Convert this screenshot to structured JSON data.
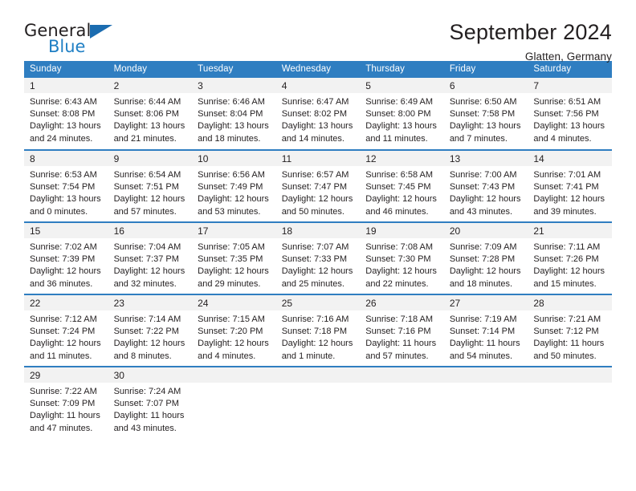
{
  "brand": {
    "name_top": "General",
    "name_bottom": "Blue",
    "flag_icon": "triangle-flag-icon",
    "accent_color": "#1f7fc4"
  },
  "header": {
    "title": "September 2024",
    "location": "Glatten, Germany"
  },
  "theme": {
    "header_blue": "#2f7ec1",
    "daynum_gray": "#f2f2f2",
    "text": "#231f20"
  },
  "calendar": {
    "weekday_headers": [
      "Sunday",
      "Monday",
      "Tuesday",
      "Wednesday",
      "Thursday",
      "Friday",
      "Saturday"
    ],
    "weeks": [
      [
        {
          "day": "1",
          "sunrise": "Sunrise: 6:43 AM",
          "sunset": "Sunset: 8:08 PM",
          "daylight1": "Daylight: 13 hours",
          "daylight2": "and 24 minutes."
        },
        {
          "day": "2",
          "sunrise": "Sunrise: 6:44 AM",
          "sunset": "Sunset: 8:06 PM",
          "daylight1": "Daylight: 13 hours",
          "daylight2": "and 21 minutes."
        },
        {
          "day": "3",
          "sunrise": "Sunrise: 6:46 AM",
          "sunset": "Sunset: 8:04 PM",
          "daylight1": "Daylight: 13 hours",
          "daylight2": "and 18 minutes."
        },
        {
          "day": "4",
          "sunrise": "Sunrise: 6:47 AM",
          "sunset": "Sunset: 8:02 PM",
          "daylight1": "Daylight: 13 hours",
          "daylight2": "and 14 minutes."
        },
        {
          "day": "5",
          "sunrise": "Sunrise: 6:49 AM",
          "sunset": "Sunset: 8:00 PM",
          "daylight1": "Daylight: 13 hours",
          "daylight2": "and 11 minutes."
        },
        {
          "day": "6",
          "sunrise": "Sunrise: 6:50 AM",
          "sunset": "Sunset: 7:58 PM",
          "daylight1": "Daylight: 13 hours",
          "daylight2": "and 7 minutes."
        },
        {
          "day": "7",
          "sunrise": "Sunrise: 6:51 AM",
          "sunset": "Sunset: 7:56 PM",
          "daylight1": "Daylight: 13 hours",
          "daylight2": "and 4 minutes."
        }
      ],
      [
        {
          "day": "8",
          "sunrise": "Sunrise: 6:53 AM",
          "sunset": "Sunset: 7:54 PM",
          "daylight1": "Daylight: 13 hours",
          "daylight2": "and 0 minutes."
        },
        {
          "day": "9",
          "sunrise": "Sunrise: 6:54 AM",
          "sunset": "Sunset: 7:51 PM",
          "daylight1": "Daylight: 12 hours",
          "daylight2": "and 57 minutes."
        },
        {
          "day": "10",
          "sunrise": "Sunrise: 6:56 AM",
          "sunset": "Sunset: 7:49 PM",
          "daylight1": "Daylight: 12 hours",
          "daylight2": "and 53 minutes."
        },
        {
          "day": "11",
          "sunrise": "Sunrise: 6:57 AM",
          "sunset": "Sunset: 7:47 PM",
          "daylight1": "Daylight: 12 hours",
          "daylight2": "and 50 minutes."
        },
        {
          "day": "12",
          "sunrise": "Sunrise: 6:58 AM",
          "sunset": "Sunset: 7:45 PM",
          "daylight1": "Daylight: 12 hours",
          "daylight2": "and 46 minutes."
        },
        {
          "day": "13",
          "sunrise": "Sunrise: 7:00 AM",
          "sunset": "Sunset: 7:43 PM",
          "daylight1": "Daylight: 12 hours",
          "daylight2": "and 43 minutes."
        },
        {
          "day": "14",
          "sunrise": "Sunrise: 7:01 AM",
          "sunset": "Sunset: 7:41 PM",
          "daylight1": "Daylight: 12 hours",
          "daylight2": "and 39 minutes."
        }
      ],
      [
        {
          "day": "15",
          "sunrise": "Sunrise: 7:02 AM",
          "sunset": "Sunset: 7:39 PM",
          "daylight1": "Daylight: 12 hours",
          "daylight2": "and 36 minutes."
        },
        {
          "day": "16",
          "sunrise": "Sunrise: 7:04 AM",
          "sunset": "Sunset: 7:37 PM",
          "daylight1": "Daylight: 12 hours",
          "daylight2": "and 32 minutes."
        },
        {
          "day": "17",
          "sunrise": "Sunrise: 7:05 AM",
          "sunset": "Sunset: 7:35 PM",
          "daylight1": "Daylight: 12 hours",
          "daylight2": "and 29 minutes."
        },
        {
          "day": "18",
          "sunrise": "Sunrise: 7:07 AM",
          "sunset": "Sunset: 7:33 PM",
          "daylight1": "Daylight: 12 hours",
          "daylight2": "and 25 minutes."
        },
        {
          "day": "19",
          "sunrise": "Sunrise: 7:08 AM",
          "sunset": "Sunset: 7:30 PM",
          "daylight1": "Daylight: 12 hours",
          "daylight2": "and 22 minutes."
        },
        {
          "day": "20",
          "sunrise": "Sunrise: 7:09 AM",
          "sunset": "Sunset: 7:28 PM",
          "daylight1": "Daylight: 12 hours",
          "daylight2": "and 18 minutes."
        },
        {
          "day": "21",
          "sunrise": "Sunrise: 7:11 AM",
          "sunset": "Sunset: 7:26 PM",
          "daylight1": "Daylight: 12 hours",
          "daylight2": "and 15 minutes."
        }
      ],
      [
        {
          "day": "22",
          "sunrise": "Sunrise: 7:12 AM",
          "sunset": "Sunset: 7:24 PM",
          "daylight1": "Daylight: 12 hours",
          "daylight2": "and 11 minutes."
        },
        {
          "day": "23",
          "sunrise": "Sunrise: 7:14 AM",
          "sunset": "Sunset: 7:22 PM",
          "daylight1": "Daylight: 12 hours",
          "daylight2": "and 8 minutes."
        },
        {
          "day": "24",
          "sunrise": "Sunrise: 7:15 AM",
          "sunset": "Sunset: 7:20 PM",
          "daylight1": "Daylight: 12 hours",
          "daylight2": "and 4 minutes."
        },
        {
          "day": "25",
          "sunrise": "Sunrise: 7:16 AM",
          "sunset": "Sunset: 7:18 PM",
          "daylight1": "Daylight: 12 hours",
          "daylight2": "and 1 minute."
        },
        {
          "day": "26",
          "sunrise": "Sunrise: 7:18 AM",
          "sunset": "Sunset: 7:16 PM",
          "daylight1": "Daylight: 11 hours",
          "daylight2": "and 57 minutes."
        },
        {
          "day": "27",
          "sunrise": "Sunrise: 7:19 AM",
          "sunset": "Sunset: 7:14 PM",
          "daylight1": "Daylight: 11 hours",
          "daylight2": "and 54 minutes."
        },
        {
          "day": "28",
          "sunrise": "Sunrise: 7:21 AM",
          "sunset": "Sunset: 7:12 PM",
          "daylight1": "Daylight: 11 hours",
          "daylight2": "and 50 minutes."
        }
      ],
      [
        {
          "day": "29",
          "sunrise": "Sunrise: 7:22 AM",
          "sunset": "Sunset: 7:09 PM",
          "daylight1": "Daylight: 11 hours",
          "daylight2": "and 47 minutes."
        },
        {
          "day": "30",
          "sunrise": "Sunrise: 7:24 AM",
          "sunset": "Sunset: 7:07 PM",
          "daylight1": "Daylight: 11 hours",
          "daylight2": "and 43 minutes."
        },
        {
          "day": "",
          "sunrise": "",
          "sunset": "",
          "daylight1": "",
          "daylight2": ""
        },
        {
          "day": "",
          "sunrise": "",
          "sunset": "",
          "daylight1": "",
          "daylight2": ""
        },
        {
          "day": "",
          "sunrise": "",
          "sunset": "",
          "daylight1": "",
          "daylight2": ""
        },
        {
          "day": "",
          "sunrise": "",
          "sunset": "",
          "daylight1": "",
          "daylight2": ""
        },
        {
          "day": "",
          "sunrise": "",
          "sunset": "",
          "daylight1": "",
          "daylight2": ""
        }
      ]
    ]
  }
}
